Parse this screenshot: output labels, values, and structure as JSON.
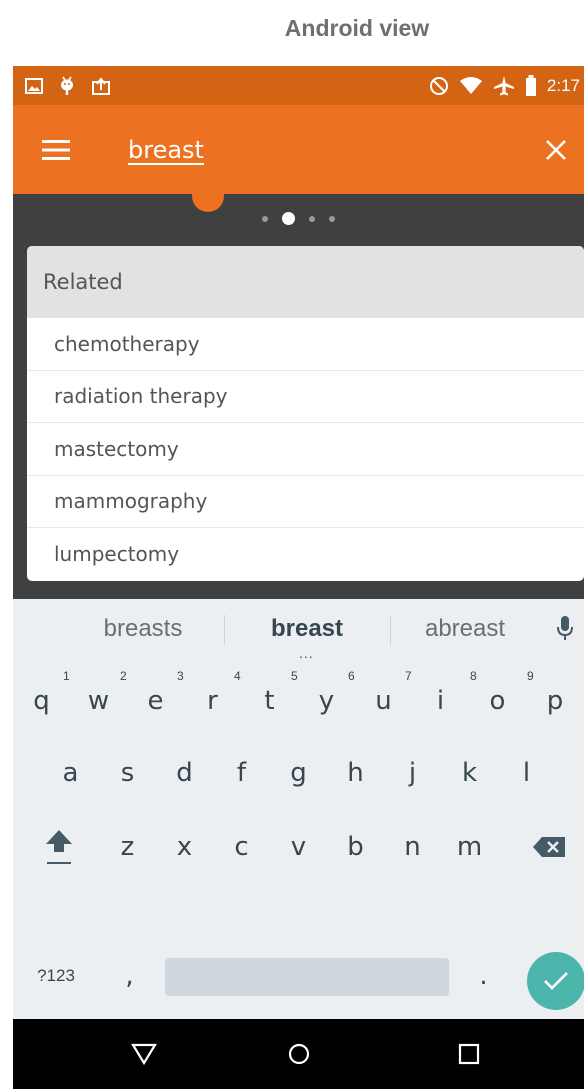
{
  "caption": "Android view",
  "status_bar": {
    "time": "2:17",
    "left_icons": [
      "image-icon",
      "android-debug-icon",
      "clipboard-upload-icon"
    ],
    "right_icons": [
      "do-not-disturb-icon",
      "wifi-icon",
      "airplane-icon",
      "battery-icon"
    ]
  },
  "toolbar": {
    "query": "breast",
    "menu_icon": "menu-icon",
    "close_icon": "close-icon"
  },
  "pager": {
    "count": 4,
    "active_index": 1
  },
  "related": {
    "header": "Related",
    "items": [
      "chemotherapy",
      "radiation therapy",
      "mastectomy",
      "mammography",
      "lumpectomy"
    ]
  },
  "suggestions": {
    "left": "breasts",
    "center": "breast",
    "right": "abreast",
    "more": "..."
  },
  "keyboard": {
    "row1": [
      "q",
      "w",
      "e",
      "r",
      "t",
      "y",
      "u",
      "i",
      "o",
      "p"
    ],
    "row1_hints": [
      "1",
      "2",
      "3",
      "4",
      "5",
      "6",
      "7",
      "8",
      "9"
    ],
    "row2": [
      "a",
      "s",
      "d",
      "f",
      "g",
      "h",
      "j",
      "k",
      "l"
    ],
    "row3": [
      "z",
      "x",
      "c",
      "v",
      "b",
      "n",
      "m"
    ],
    "symbols_label": "?123",
    "comma": ",",
    "period": "."
  },
  "colors": {
    "status_bar": "#d36414",
    "toolbar": "#ec7121",
    "enter": "#4db6ac"
  }
}
